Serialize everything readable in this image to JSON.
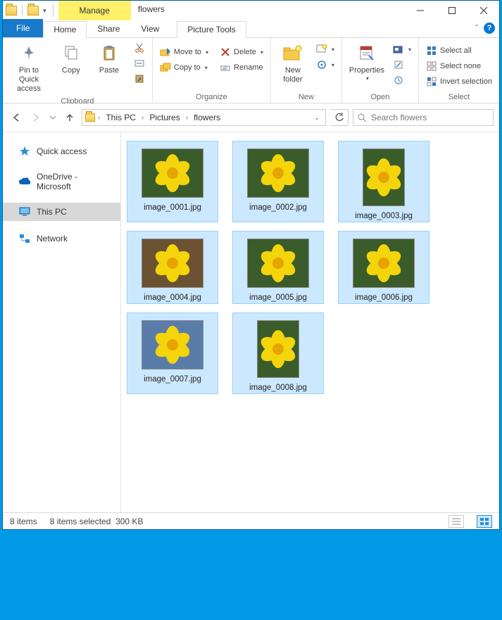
{
  "title": "flowers",
  "ctx_tab_group": "Manage",
  "ctx_tab": "Picture Tools",
  "tabs": {
    "file": "File",
    "home": "Home",
    "share": "Share",
    "view": "View"
  },
  "ribbon": {
    "clipboard": {
      "label": "Clipboard",
      "pin": "Pin to Quick access",
      "copy": "Copy",
      "paste": "Paste"
    },
    "organize": {
      "label": "Organize",
      "moveto": "Move to",
      "copyto": "Copy to",
      "delete": "Delete",
      "rename": "Rename"
    },
    "new": {
      "label": "New",
      "newfolder": "New folder"
    },
    "open": {
      "label": "Open",
      "properties": "Properties"
    },
    "select": {
      "label": "Select",
      "all": "Select all",
      "none": "Select none",
      "invert": "Invert selection"
    }
  },
  "breadcrumb": {
    "pc": "This PC",
    "pictures": "Pictures",
    "folder": "flowers"
  },
  "search_placeholder": "Search flowers",
  "tree": {
    "quick": "Quick access",
    "onedrive": "OneDrive - Microsoft",
    "thispc": "This PC",
    "network": "Network"
  },
  "files": [
    {
      "name": "image_0001.jpg"
    },
    {
      "name": "image_0002.jpg"
    },
    {
      "name": "image_0003.jpg"
    },
    {
      "name": "image_0004.jpg"
    },
    {
      "name": "image_0005.jpg"
    },
    {
      "name": "image_0006.jpg"
    },
    {
      "name": "image_0007.jpg"
    },
    {
      "name": "image_0008.jpg"
    }
  ],
  "status": {
    "count": "8 items",
    "selected": "8 items selected",
    "size": "300 KB"
  }
}
